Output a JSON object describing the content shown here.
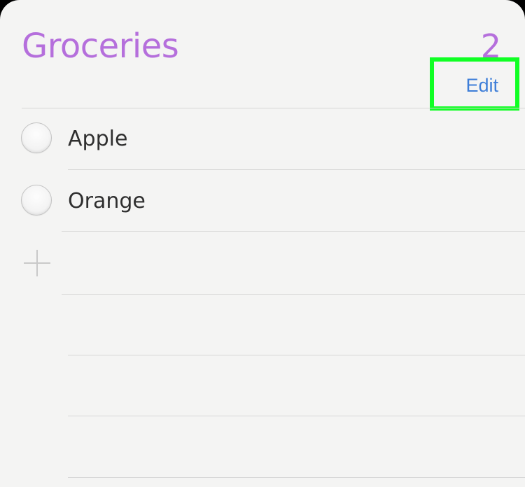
{
  "list": {
    "title": "Groceries",
    "count": "2",
    "edit_label": "Edit",
    "items": [
      {
        "label": "Apple",
        "completed": false
      },
      {
        "label": "Orange",
        "completed": false
      }
    ]
  },
  "colors": {
    "accent": "#b56fdc",
    "link": "#3e7ed8",
    "highlight": "#10ff24"
  }
}
